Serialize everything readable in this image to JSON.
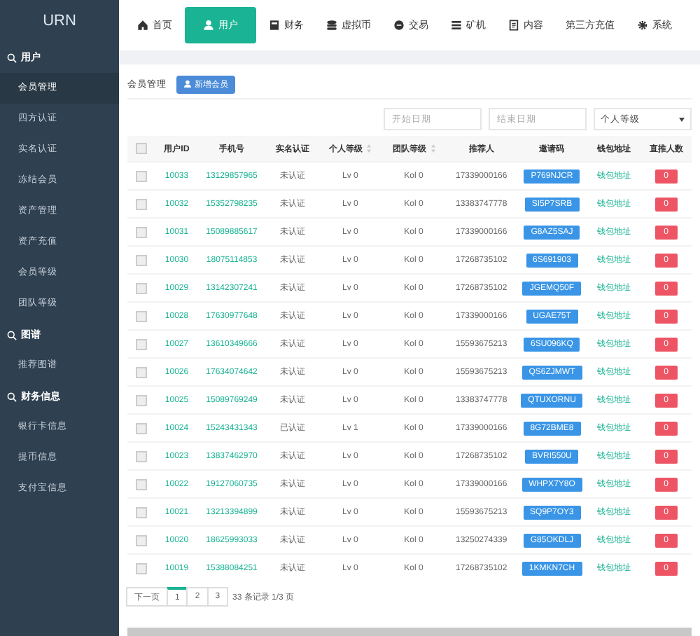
{
  "logo": "URN",
  "nav": [
    {
      "label": "首页",
      "selected": false
    },
    {
      "label": "用户",
      "selected": true
    },
    {
      "label": "财务",
      "selected": false
    },
    {
      "label": "虚拟币",
      "selected": false
    },
    {
      "label": "交易",
      "selected": false
    },
    {
      "label": "矿机",
      "selected": false
    },
    {
      "label": "内容",
      "selected": false
    },
    {
      "label": "第三方充值",
      "selected": false
    },
    {
      "label": "系统",
      "selected": false
    }
  ],
  "sidebar": [
    {
      "label": "用户",
      "items": [
        {
          "label": "会员管理",
          "selected": true
        },
        {
          "label": "四方认证",
          "selected": false
        },
        {
          "label": "实名认证",
          "selected": false
        },
        {
          "label": "冻结会员",
          "selected": false
        },
        {
          "label": "资产管理",
          "selected": false
        },
        {
          "label": "资产充值",
          "selected": false
        },
        {
          "label": "会员等级",
          "selected": false
        },
        {
          "label": "团队等级",
          "selected": false
        }
      ]
    },
    {
      "label": "图谱",
      "items": [
        {
          "label": "推荐图谱",
          "selected": false
        }
      ]
    },
    {
      "label": "财务信息",
      "items": [
        {
          "label": "银行卡信息",
          "selected": false
        },
        {
          "label": "提币信息",
          "selected": false
        },
        {
          "label": "支付宝信息",
          "selected": false
        }
      ]
    }
  ],
  "page_title": "会员管理",
  "add_button": "新增会员",
  "filters": {
    "start": {
      "placeholder": "开始日期"
    },
    "end": {
      "placeholder": "结束日期"
    },
    "level_select": "个人等级"
  },
  "table": {
    "header_checked": false,
    "columns": [
      {
        "label": "用户ID",
        "sortable": false
      },
      {
        "label": "手机号",
        "sortable": false
      },
      {
        "label": "实名认证",
        "sortable": false
      },
      {
        "label": "个人等级",
        "sortable": true
      },
      {
        "label": "团队等级",
        "sortable": true
      },
      {
        "label": "推荐人",
        "sortable": false
      },
      {
        "label": "邀请码",
        "sortable": false
      },
      {
        "label": "钱包地址",
        "sortable": false
      },
      {
        "label": "直推人数",
        "sortable": false
      }
    ],
    "rows": [
      {
        "checked": false,
        "id": "10033",
        "phone": "13129857965",
        "auth": "未认证",
        "level": "Lv 0",
        "team": "Kol 0",
        "referrer": "17339000166",
        "code": "P769NJCR",
        "wallet": "钱包地址",
        "direct": "0"
      },
      {
        "checked": false,
        "id": "10032",
        "phone": "15352798235",
        "auth": "未认证",
        "level": "Lv 0",
        "team": "Kol 0",
        "referrer": "13383747778",
        "code": "SI5P7SRB",
        "wallet": "钱包地址",
        "direct": "0"
      },
      {
        "checked": false,
        "id": "10031",
        "phone": "15089885617",
        "auth": "未认证",
        "level": "Lv 0",
        "team": "Kol 0",
        "referrer": "17339000166",
        "code": "G8AZ5SAJ",
        "wallet": "钱包地址",
        "direct": "0"
      },
      {
        "checked": false,
        "id": "10030",
        "phone": "18075114853",
        "auth": "未认证",
        "level": "Lv 0",
        "team": "Kol 0",
        "referrer": "17268735102",
        "code": "6S691903",
        "wallet": "钱包地址",
        "direct": "0"
      },
      {
        "checked": false,
        "id": "10029",
        "phone": "13142307241",
        "auth": "未认证",
        "level": "Lv 0",
        "team": "Kol 0",
        "referrer": "17268735102",
        "code": "JGEMQ50F",
        "wallet": "钱包地址",
        "direct": "0"
      },
      {
        "checked": false,
        "id": "10028",
        "phone": "17630977648",
        "auth": "未认证",
        "level": "Lv 0",
        "team": "Kol 0",
        "referrer": "17339000166",
        "code": "UGAE75T",
        "wallet": "钱包地址",
        "direct": "0"
      },
      {
        "checked": false,
        "id": "10027",
        "phone": "13610349666",
        "auth": "未认证",
        "level": "Lv 0",
        "team": "Kol 0",
        "referrer": "15593675213",
        "code": "6SU096KQ",
        "wallet": "钱包地址",
        "direct": "0"
      },
      {
        "checked": false,
        "id": "10026",
        "phone": "17634074642",
        "auth": "未认证",
        "level": "Lv 0",
        "team": "Kol 0",
        "referrer": "15593675213",
        "code": "QS6ZJMWT",
        "wallet": "钱包地址",
        "direct": "0"
      },
      {
        "checked": false,
        "id": "10025",
        "phone": "15089769249",
        "auth": "未认证",
        "level": "Lv 0",
        "team": "Kol 0",
        "referrer": "13383747778",
        "code": "QTUXORNU",
        "wallet": "钱包地址",
        "direct": "0"
      },
      {
        "checked": false,
        "id": "10024",
        "phone": "15243431343",
        "auth": "已认证",
        "level": "Lv 1",
        "team": "Kol 0",
        "referrer": "17339000166",
        "code": "8G72BME8",
        "wallet": "钱包地址",
        "direct": "0"
      },
      {
        "checked": false,
        "id": "10023",
        "phone": "13837462970",
        "auth": "未认证",
        "level": "Lv 0",
        "team": "Kol 0",
        "referrer": "17268735102",
        "code": "BVRI550U",
        "wallet": "钱包地址",
        "direct": "0"
      },
      {
        "checked": false,
        "id": "10022",
        "phone": "19127060735",
        "auth": "未认证",
        "level": "Lv 0",
        "team": "Kol 0",
        "referrer": "17339000166",
        "code": "WHPX7Y8O",
        "wallet": "钱包地址",
        "direct": "0"
      },
      {
        "checked": false,
        "id": "10021",
        "phone": "13213394899",
        "auth": "未认证",
        "level": "Lv 0",
        "team": "Kol 0",
        "referrer": "15593675213",
        "code": "SQ9P7OY3",
        "wallet": "钱包地址",
        "direct": "0"
      },
      {
        "checked": false,
        "id": "10020",
        "phone": "18625993033",
        "auth": "未认证",
        "level": "Lv 0",
        "team": "Kol 0",
        "referrer": "13250274339",
        "code": "G85OKDLJ",
        "wallet": "钱包地址",
        "direct": "0"
      },
      {
        "checked": false,
        "id": "10019",
        "phone": "15388084251",
        "auth": "未认证",
        "level": "Lv 0",
        "team": "Kol 0",
        "referrer": "17268735102",
        "code": "1KMKN7CH",
        "wallet": "钱包地址",
        "direct": "0"
      }
    ]
  },
  "pagination": {
    "next": "下一页",
    "pages": [
      {
        "label": "1",
        "selected": true
      },
      {
        "label": "2",
        "selected": false
      },
      {
        "label": "3",
        "selected": false
      }
    ],
    "summary": "33 条记录 1/3 页"
  }
}
